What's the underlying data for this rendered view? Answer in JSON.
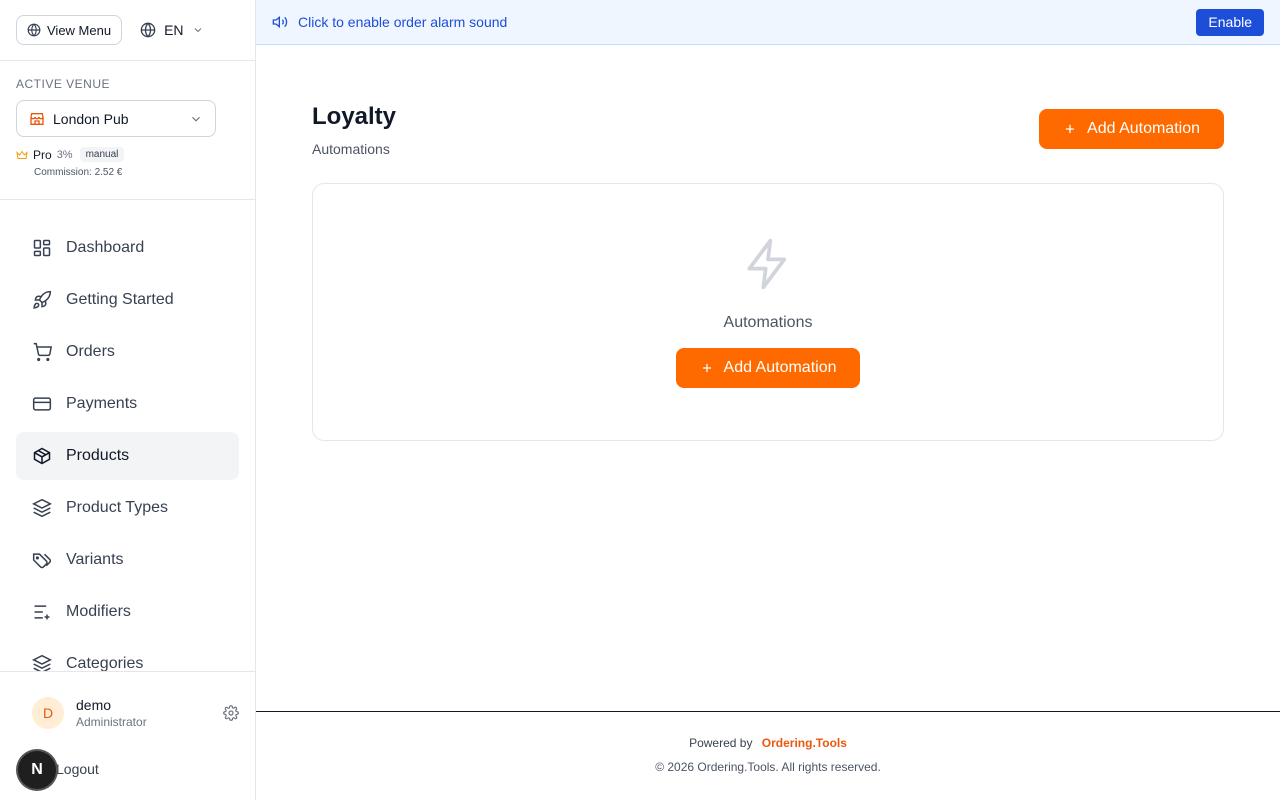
{
  "sidebar": {
    "view_menu_label": "View Menu",
    "language": "EN",
    "venue_label": "Active Venue",
    "venue_name": "London Pub",
    "plan_name": "Pro",
    "plan_percent": "3%",
    "plan_badge": "manual",
    "commission": "Commission: 2.52 €",
    "nav": [
      {
        "label": "Dashboard",
        "icon": "dashboard-icon"
      },
      {
        "label": "Getting Started",
        "icon": "rocket-icon"
      },
      {
        "label": "Orders",
        "icon": "cart-icon"
      },
      {
        "label": "Payments",
        "icon": "credit-card-icon"
      },
      {
        "label": "Products",
        "icon": "package-icon",
        "active": true
      },
      {
        "label": "Product Types",
        "icon": "layers-icon"
      },
      {
        "label": "Variants",
        "icon": "tag-icon"
      },
      {
        "label": "Modifiers",
        "icon": "list-plus-icon"
      },
      {
        "label": "Categories",
        "icon": "layers-icon"
      }
    ],
    "user": {
      "initial": "D",
      "name": "demo",
      "role": "Administrator"
    },
    "logout_label": "Logout",
    "n_badge": "N"
  },
  "alarm": {
    "text": "Click to enable order alarm sound",
    "button": "Enable"
  },
  "page": {
    "title": "Loyalty",
    "subtitle": "Automations",
    "add_button": "Add Automation",
    "empty_text": "Automations",
    "empty_button": "Add Automation"
  },
  "footer": {
    "powered_by": "Powered by",
    "brand": "Ordering.Tools",
    "copyright": "© 2026 Ordering.Tools. All rights reserved."
  },
  "colors": {
    "accent": "#ff6a00",
    "alarm_blue": "#1d4ed8"
  }
}
